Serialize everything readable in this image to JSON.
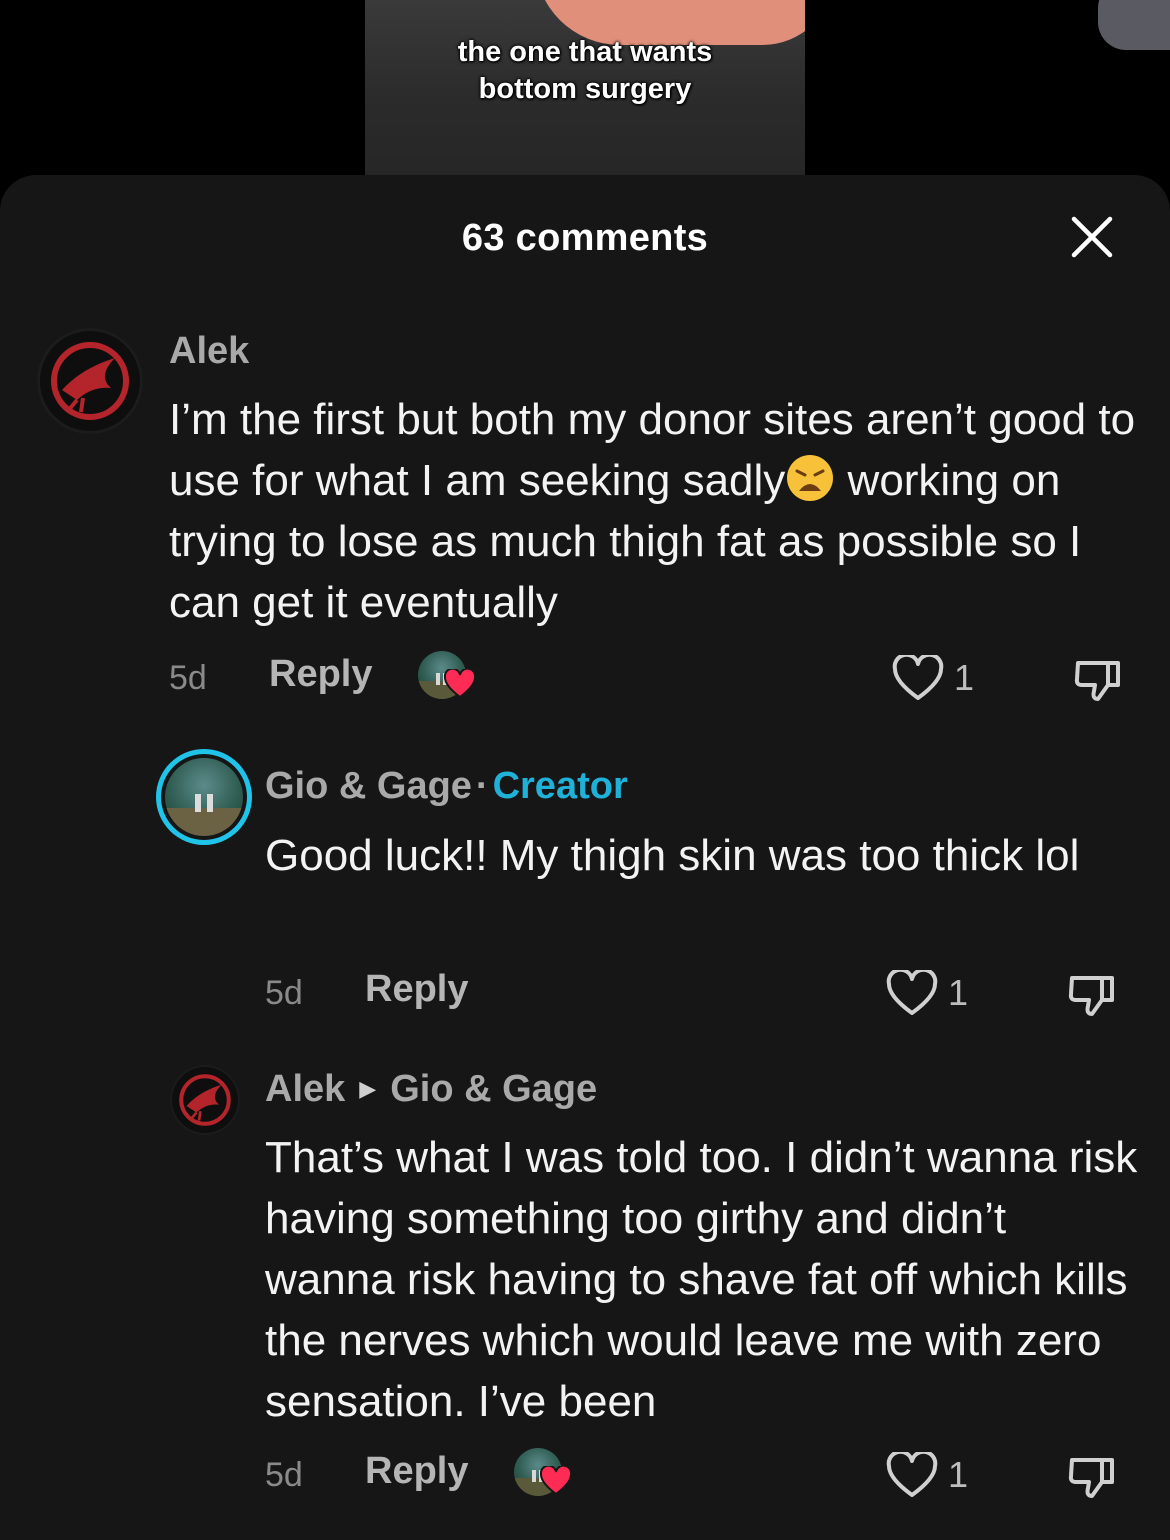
{
  "video": {
    "caption_line1": "the one that wants",
    "caption_line2": "bottom surgery"
  },
  "sheet": {
    "title": "63 comments",
    "close_icon": "close-icon"
  },
  "comments": [
    {
      "username": "Alek",
      "text_before_emoji": "I’m the first but both my donor sites aren’t good to use for what I am seeking sadly",
      "emoji": "weary-face-emoji",
      "text_after_emoji": " working on trying to lose as much thigh fat as possible so I can get it eventually",
      "time": "5d",
      "reply_label": "Reply",
      "liked_by_creator": true,
      "likes": "1"
    },
    {
      "username": "Gio & Gage",
      "separator": "·",
      "badge": "Creator",
      "text": "Good luck!! My thigh skin was too thick lol",
      "time": "5d",
      "reply_label": "Reply",
      "likes": "1"
    },
    {
      "username": "Alek",
      "reply_to": "Gio & Gage",
      "text": "That’s what I was told too. I didn’t wanna risk having something too girthy and didn’t wanna risk having to shave fat off which kills the nerves which would leave me with zero sensation. I’ve been",
      "time": "5d",
      "reply_label": "Reply",
      "liked_by_creator": true,
      "likes": "1"
    }
  ],
  "colors": {
    "sheet_bg": "#161616",
    "creator_badge": "#1fb1d8",
    "like_heart": "#fe2c55",
    "avatar_ring": "#20c4e8"
  }
}
